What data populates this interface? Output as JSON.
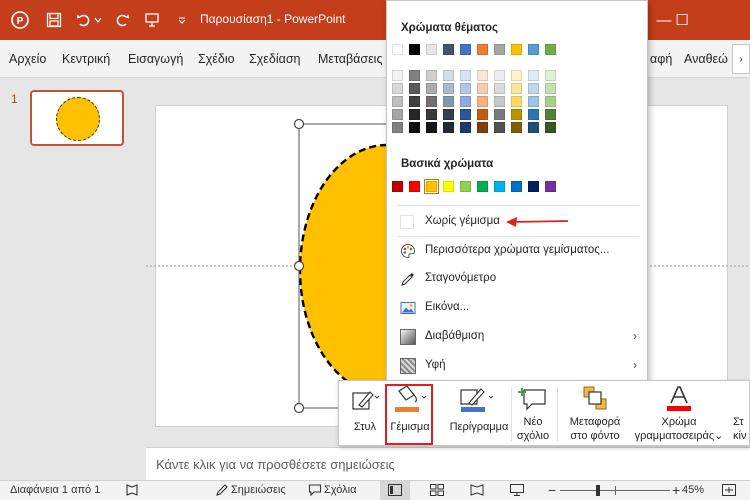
{
  "title_bar": {
    "title": "Παρουσίαση1 - PowerPoint",
    "bg_color": "#c43e1c",
    "restore_glyph": "❐",
    "minimize_glyph": "—",
    "maximize_glyph": "☐"
  },
  "ribbon": {
    "tabs": [
      "Αρχείο",
      "Κεντρική",
      "Εισαγωγή",
      "Σχέδιο",
      "Σχεδίαση",
      "Μεταβάσεις",
      "αφή",
      "Αναθεώ"
    ],
    "scroll_glyph": "›"
  },
  "slide_panel": {
    "slide_number": "1"
  },
  "fill_menu": {
    "theme_colors_label": "Χρώματα θέματος",
    "theme_colors": [
      "#ffffff",
      "#000000",
      "#e7e6e6",
      "#44546a",
      "#4472c4",
      "#ed7d31",
      "#a5a5a5",
      "#ffc000",
      "#5b9bd5",
      "#70ad47"
    ],
    "theme_shades": [
      [
        "#f2f2f2",
        "#d9d9d9",
        "#bfbfbf",
        "#a6a6a6",
        "#808080"
      ],
      [
        "#808080",
        "#595959",
        "#404040",
        "#262626",
        "#0d0d0d"
      ],
      [
        "#d0cece",
        "#aeabab",
        "#757171",
        "#3a3838",
        "#171616"
      ],
      [
        "#d6dce4",
        "#acb9ca",
        "#8497b0",
        "#333f4f",
        "#222a35"
      ],
      [
        "#d9e2f3",
        "#b4c6e7",
        "#8eaadb",
        "#2f5496",
        "#1f3864"
      ],
      [
        "#fbe5d5",
        "#f7cbac",
        "#f4b083",
        "#c55a11",
        "#833c0b"
      ],
      [
        "#ededed",
        "#dbdbdb",
        "#c9c9c9",
        "#7b7b7b",
        "#525252"
      ],
      [
        "#fff2cc",
        "#fee599",
        "#ffd965",
        "#bf9000",
        "#7f6000"
      ],
      [
        "#deebf6",
        "#bdd7ee",
        "#9dc3e6",
        "#2e75b5",
        "#1f4e79"
      ],
      [
        "#e2efd9",
        "#c5e0b3",
        "#a8d08d",
        "#538135",
        "#375623"
      ]
    ],
    "standard_colors_label": "Βασικά χρώματα",
    "standard_colors": [
      "#c00000",
      "#ff0000",
      "#ffc000",
      "#ffff00",
      "#92d050",
      "#00b050",
      "#00b0f0",
      "#0070c0",
      "#002060",
      "#7030a0"
    ],
    "items": {
      "no_fill": "Χωρίς γέμισμα",
      "more_colors": "Περισσότερα χρώματα γεμίσματος...",
      "eyedropper": "Σταγονόμετρο",
      "picture": "Εικόνα...",
      "gradient": "Διαβάθμιση",
      "texture": "Υφή"
    },
    "submenu_glyph": "›",
    "arrow_color": "#e02020"
  },
  "mini_toolbar": {
    "style_label": "Στυλ",
    "fill_label": "Γέμισμα",
    "outline_label": "Περίγραμμα",
    "new_comment_label_1": "Νέο",
    "new_comment_label_2": "σχόλιο",
    "bring_to_front_label_1": "Μεταφορά",
    "bring_to_front_label_2": "στο φόντο",
    "font_color_label_1": "Χρώμα",
    "font_color_label_2": "γραμματοσειράς",
    "font_color_chevron": "⌄",
    "cut_label_1": "Στ",
    "cut_label_2": "κίν",
    "fill_accent": "#ed7d31",
    "outline_accent": "#4472c4",
    "font_color_accent": "#ff0000",
    "highlight_color": "#e02020"
  },
  "notes": {
    "placeholder": "Κάντε κλικ για να προσθέσετε σημειώσεις"
  },
  "status_bar": {
    "slide_info": "Διαφάνεια 1 από 1",
    "notes_label": "Σημειώσεις",
    "comments_label": "Σχόλια",
    "zoom_out": "−",
    "zoom_in": "+",
    "zoom": "45%",
    "zoom_fraction": 0.45
  },
  "slide": {
    "shape_fill": "#ffc000"
  }
}
